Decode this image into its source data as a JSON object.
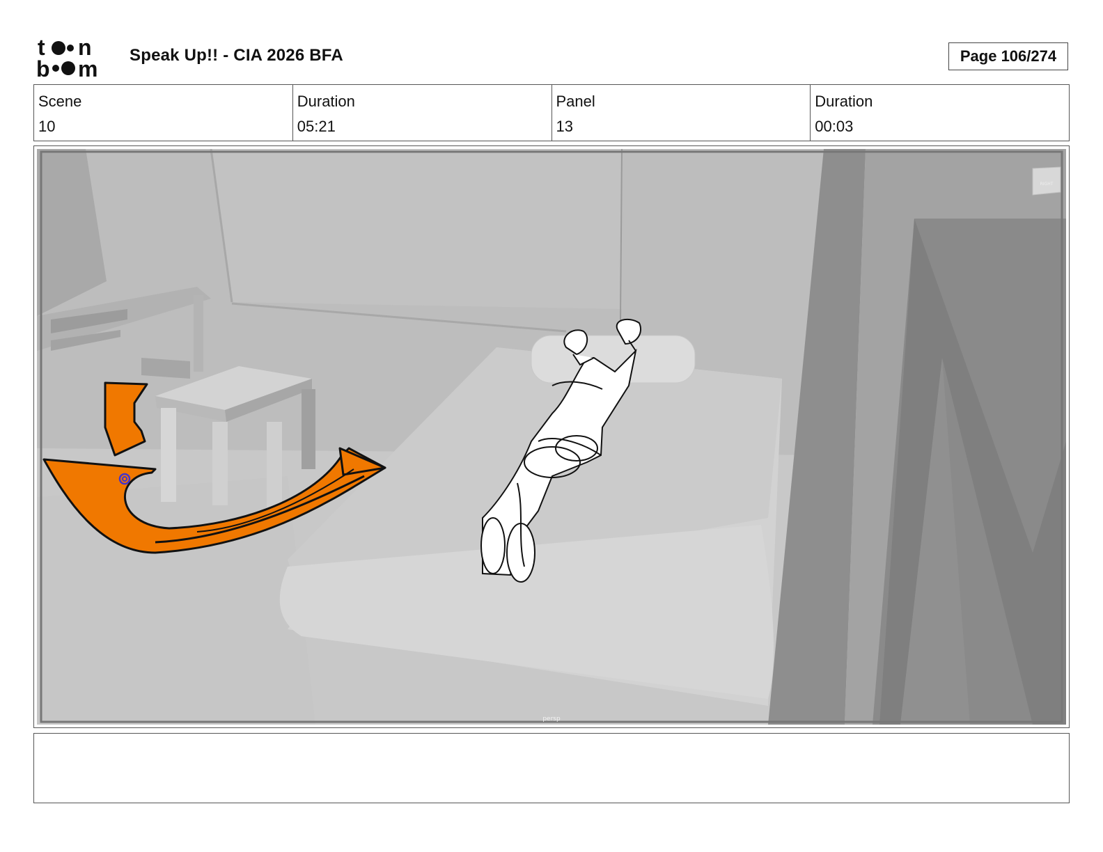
{
  "header": {
    "logo_text": "toonboom",
    "title": "Speak Up!! - CIA 2026 BFA",
    "page": "Page 106/274"
  },
  "info": [
    {
      "label": "Scene",
      "value": "10"
    },
    {
      "label": "Duration",
      "value": "05:21"
    },
    {
      "label": "Panel",
      "value": "13"
    },
    {
      "label": "Duration",
      "value": "00:03"
    }
  ],
  "panel": {
    "viewport_label": "persp",
    "view_cube_label": "RIGHT",
    "arrow_color": "#f07800",
    "spiral_color": "#4433cc"
  },
  "notes": {
    "text": ""
  }
}
